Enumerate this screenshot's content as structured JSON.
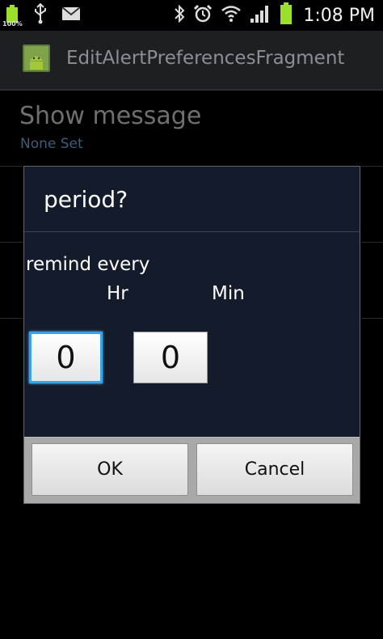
{
  "status_bar": {
    "battery_percent_label": "100%",
    "time": "1:08 PM",
    "icons": [
      "battery-icon",
      "usb-icon",
      "mail-icon",
      "bluetooth-icon",
      "alarm-icon",
      "wifi-icon",
      "signal-icon",
      "battery-icon"
    ],
    "battery_color": "#9be02a"
  },
  "action_bar": {
    "title": "EditAlertPreferencesFragment"
  },
  "preferences": [
    {
      "title": "Show message",
      "summary": "None Set"
    }
  ],
  "dialog": {
    "title": "period?",
    "prompt": "remind every",
    "hours_label": "Hr",
    "minutes_label": "Min",
    "hours_value": "0",
    "minutes_value": "0",
    "ok_label": "OK",
    "cancel_label": "Cancel",
    "accent_color": "#3aa2e8"
  }
}
